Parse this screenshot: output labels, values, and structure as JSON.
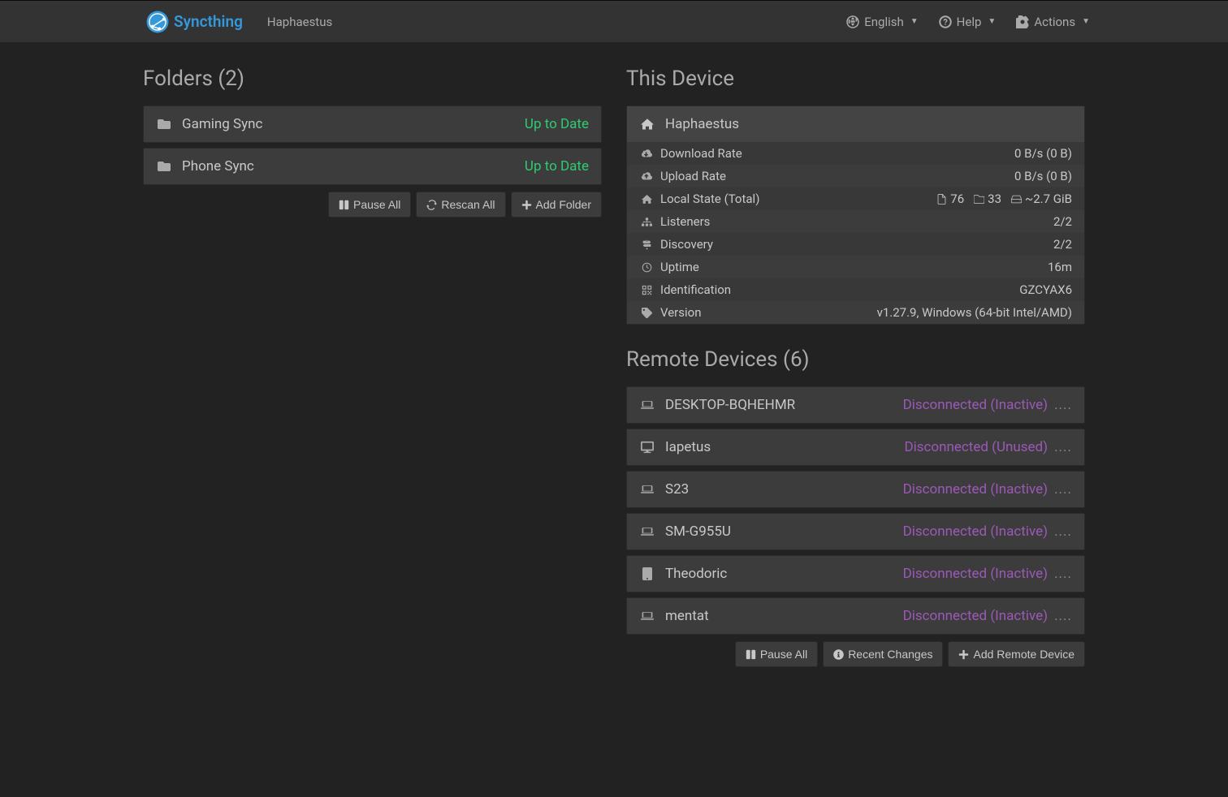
{
  "brand": "Syncthing",
  "device_name": "Haphaestus",
  "nav": {
    "language": "English",
    "help": "Help",
    "actions": "Actions"
  },
  "folders": {
    "title": "Folders (2)",
    "items": [
      {
        "name": "Gaming Sync",
        "status": "Up to Date"
      },
      {
        "name": "Phone Sync",
        "status": "Up to Date"
      }
    ],
    "buttons": {
      "pause_all": "Pause All",
      "rescan_all": "Rescan All",
      "add_folder": "Add Folder"
    }
  },
  "this_device": {
    "title": "This Device",
    "name": "Haphaestus",
    "rows": {
      "download_rate": {
        "label": "Download Rate",
        "value": "0 B/s (0 B)"
      },
      "upload_rate": {
        "label": "Upload Rate",
        "value": "0 B/s (0 B)"
      },
      "local_state": {
        "label": "Local State (Total)",
        "files": "76",
        "dirs": "33",
        "size": "~2.7 GiB"
      },
      "listeners": {
        "label": "Listeners",
        "value": "2/2"
      },
      "discovery": {
        "label": "Discovery",
        "value": "2/2"
      },
      "uptime": {
        "label": "Uptime",
        "value": "16m"
      },
      "identification": {
        "label": "Identification",
        "value": "GZCYAX6"
      },
      "version": {
        "label": "Version",
        "value": "v1.27.9, Windows (64-bit Intel/AMD)"
      }
    }
  },
  "remote": {
    "title": "Remote Devices (6)",
    "items": [
      {
        "name": "DESKTOP-BQHEHMR",
        "status": "Disconnected (Inactive)"
      },
      {
        "name": "Iapetus",
        "status": "Disconnected (Unused)"
      },
      {
        "name": "S23",
        "status": "Disconnected (Inactive)"
      },
      {
        "name": "SM-G955U",
        "status": "Disconnected (Inactive)"
      },
      {
        "name": "Theodoric",
        "status": "Disconnected (Inactive)"
      },
      {
        "name": "mentat",
        "status": "Disconnected (Inactive)"
      }
    ],
    "buttons": {
      "pause_all": "Pause All",
      "recent_changes": "Recent Changes",
      "add_remote": "Add Remote Device"
    }
  }
}
